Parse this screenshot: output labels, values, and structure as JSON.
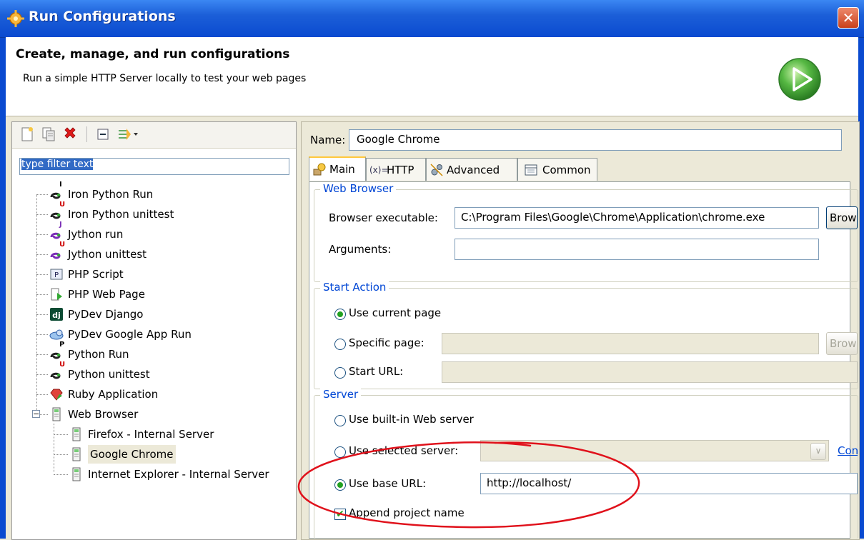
{
  "window": {
    "title": "Run Configurations",
    "close_label": "✕"
  },
  "header": {
    "title": "Create, manage, and run configurations",
    "description": "Run a simple HTTP Server locally to test your web pages"
  },
  "left_panel": {
    "filter_placeholder": "type filter text",
    "tree": [
      {
        "label": "Iron Python Run",
        "icon": "python-run-icon",
        "icon_badge": "I",
        "badge_color": "#000000"
      },
      {
        "label": "Iron Python unittest",
        "icon": "python-unittest-icon",
        "icon_badge": "U",
        "badge_color": "#cc0000"
      },
      {
        "label": "Jython run",
        "icon": "jython-run-icon",
        "icon_badge": "J",
        "badge_color": "#7a2fb6"
      },
      {
        "label": "Jython unittest",
        "icon": "jython-unittest-icon",
        "icon_badge": "U",
        "badge_color": "#cc0000"
      },
      {
        "label": "PHP Script",
        "icon": "php-script-icon"
      },
      {
        "label": "PHP Web Page",
        "icon": "php-web-page-icon"
      },
      {
        "label": "PyDev Django",
        "icon": "django-icon"
      },
      {
        "label": "PyDev Google App Run",
        "icon": "google-app-icon"
      },
      {
        "label": "Python Run",
        "icon": "python-run-icon",
        "icon_badge": "P",
        "badge_color": "#000000"
      },
      {
        "label": "Python unittest",
        "icon": "python-unittest-icon",
        "icon_badge": "U",
        "badge_color": "#cc0000"
      },
      {
        "label": "Ruby Application",
        "icon": "ruby-icon"
      },
      {
        "label": "Web Browser",
        "icon": "web-browser-icon",
        "expanded": true
      },
      {
        "label": "Firefox - Internal Server",
        "icon": "browser-config-icon"
      },
      {
        "label": "Google Chrome",
        "icon": "browser-config-icon",
        "selected": true
      },
      {
        "label": "Internet Explorer - Internal Server",
        "icon": "browser-config-icon"
      }
    ]
  },
  "right_panel": {
    "name_label": "Name:",
    "name_value": "Google Chrome",
    "tabs": [
      {
        "label": "Main",
        "icon": "main-tab-icon",
        "active": true
      },
      {
        "label": "HTTP",
        "icon": "http-tab-icon"
      },
      {
        "label": "Advanced",
        "icon": "advanced-tab-icon"
      },
      {
        "label": "Common",
        "icon": "common-tab-icon"
      }
    ],
    "web_browser": {
      "legend": "Web Browser",
      "executable_label": "Browser executable:",
      "executable_value": "C:\\Program Files\\Google\\Chrome\\Application\\chrome.exe",
      "browse_label": "Browse...",
      "arguments_label": "Arguments:",
      "arguments_value": ""
    },
    "start_action": {
      "legend": "Start Action",
      "current_page_label": "Use current page",
      "specific_page_label": "Specific page:",
      "start_url_label": "Start URL:",
      "browse_label": "Browse...",
      "selected": "current_page"
    },
    "server": {
      "legend": "Server",
      "builtin_label": "Use built-in Web server",
      "selected_server_label": "Use selected server:",
      "configure_label": "Configure...",
      "base_url_label": "Use base URL:",
      "base_url_value": "http://localhost/",
      "append_label": "Append project name",
      "append_checked": true,
      "selected": "base_url"
    }
  },
  "colors": {
    "titlebar": "#0a4ad0",
    "legend": "#0046d5",
    "annotation": "#e0111b",
    "run_button": "#3fa83a"
  }
}
